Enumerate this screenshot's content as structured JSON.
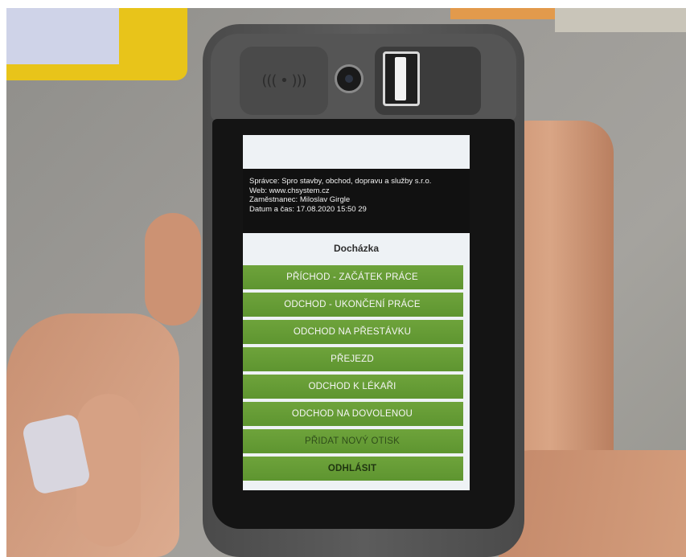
{
  "screen": {
    "info": {
      "admin": "Správce: Spro stavby, obchod, dopravu a služby s.r.o.",
      "web": "Web: www.chsystem.cz",
      "employee": "Zaměstnanec: Miloslav Girgle",
      "datetime": "Datum a čas: 17.08.2020 15:50 29"
    },
    "section_title": "Docházka",
    "menu": [
      "PŘÍCHOD - ZAČÁTEK PRÁCE",
      "ODCHOD - UKONČENÍ PRÁCE",
      "ODCHOD NA  PŘESTÁVKU",
      "PŘEJEZD",
      "ODCHOD K LÉKAŘI",
      "ODCHOD NA DOVOLENOU",
      "PŘIDAT NOVÝ OTISK",
      "ODHLÁSIT"
    ]
  },
  "device": {
    "nfc_icon": "((( • )))",
    "icons": [
      "nfc-icon",
      "camera-icon",
      "fingerprint-scanner-icon"
    ]
  },
  "colors": {
    "button_green": "#6ea33b",
    "info_bg": "#111111",
    "screen_bg": "#eef2f5"
  }
}
